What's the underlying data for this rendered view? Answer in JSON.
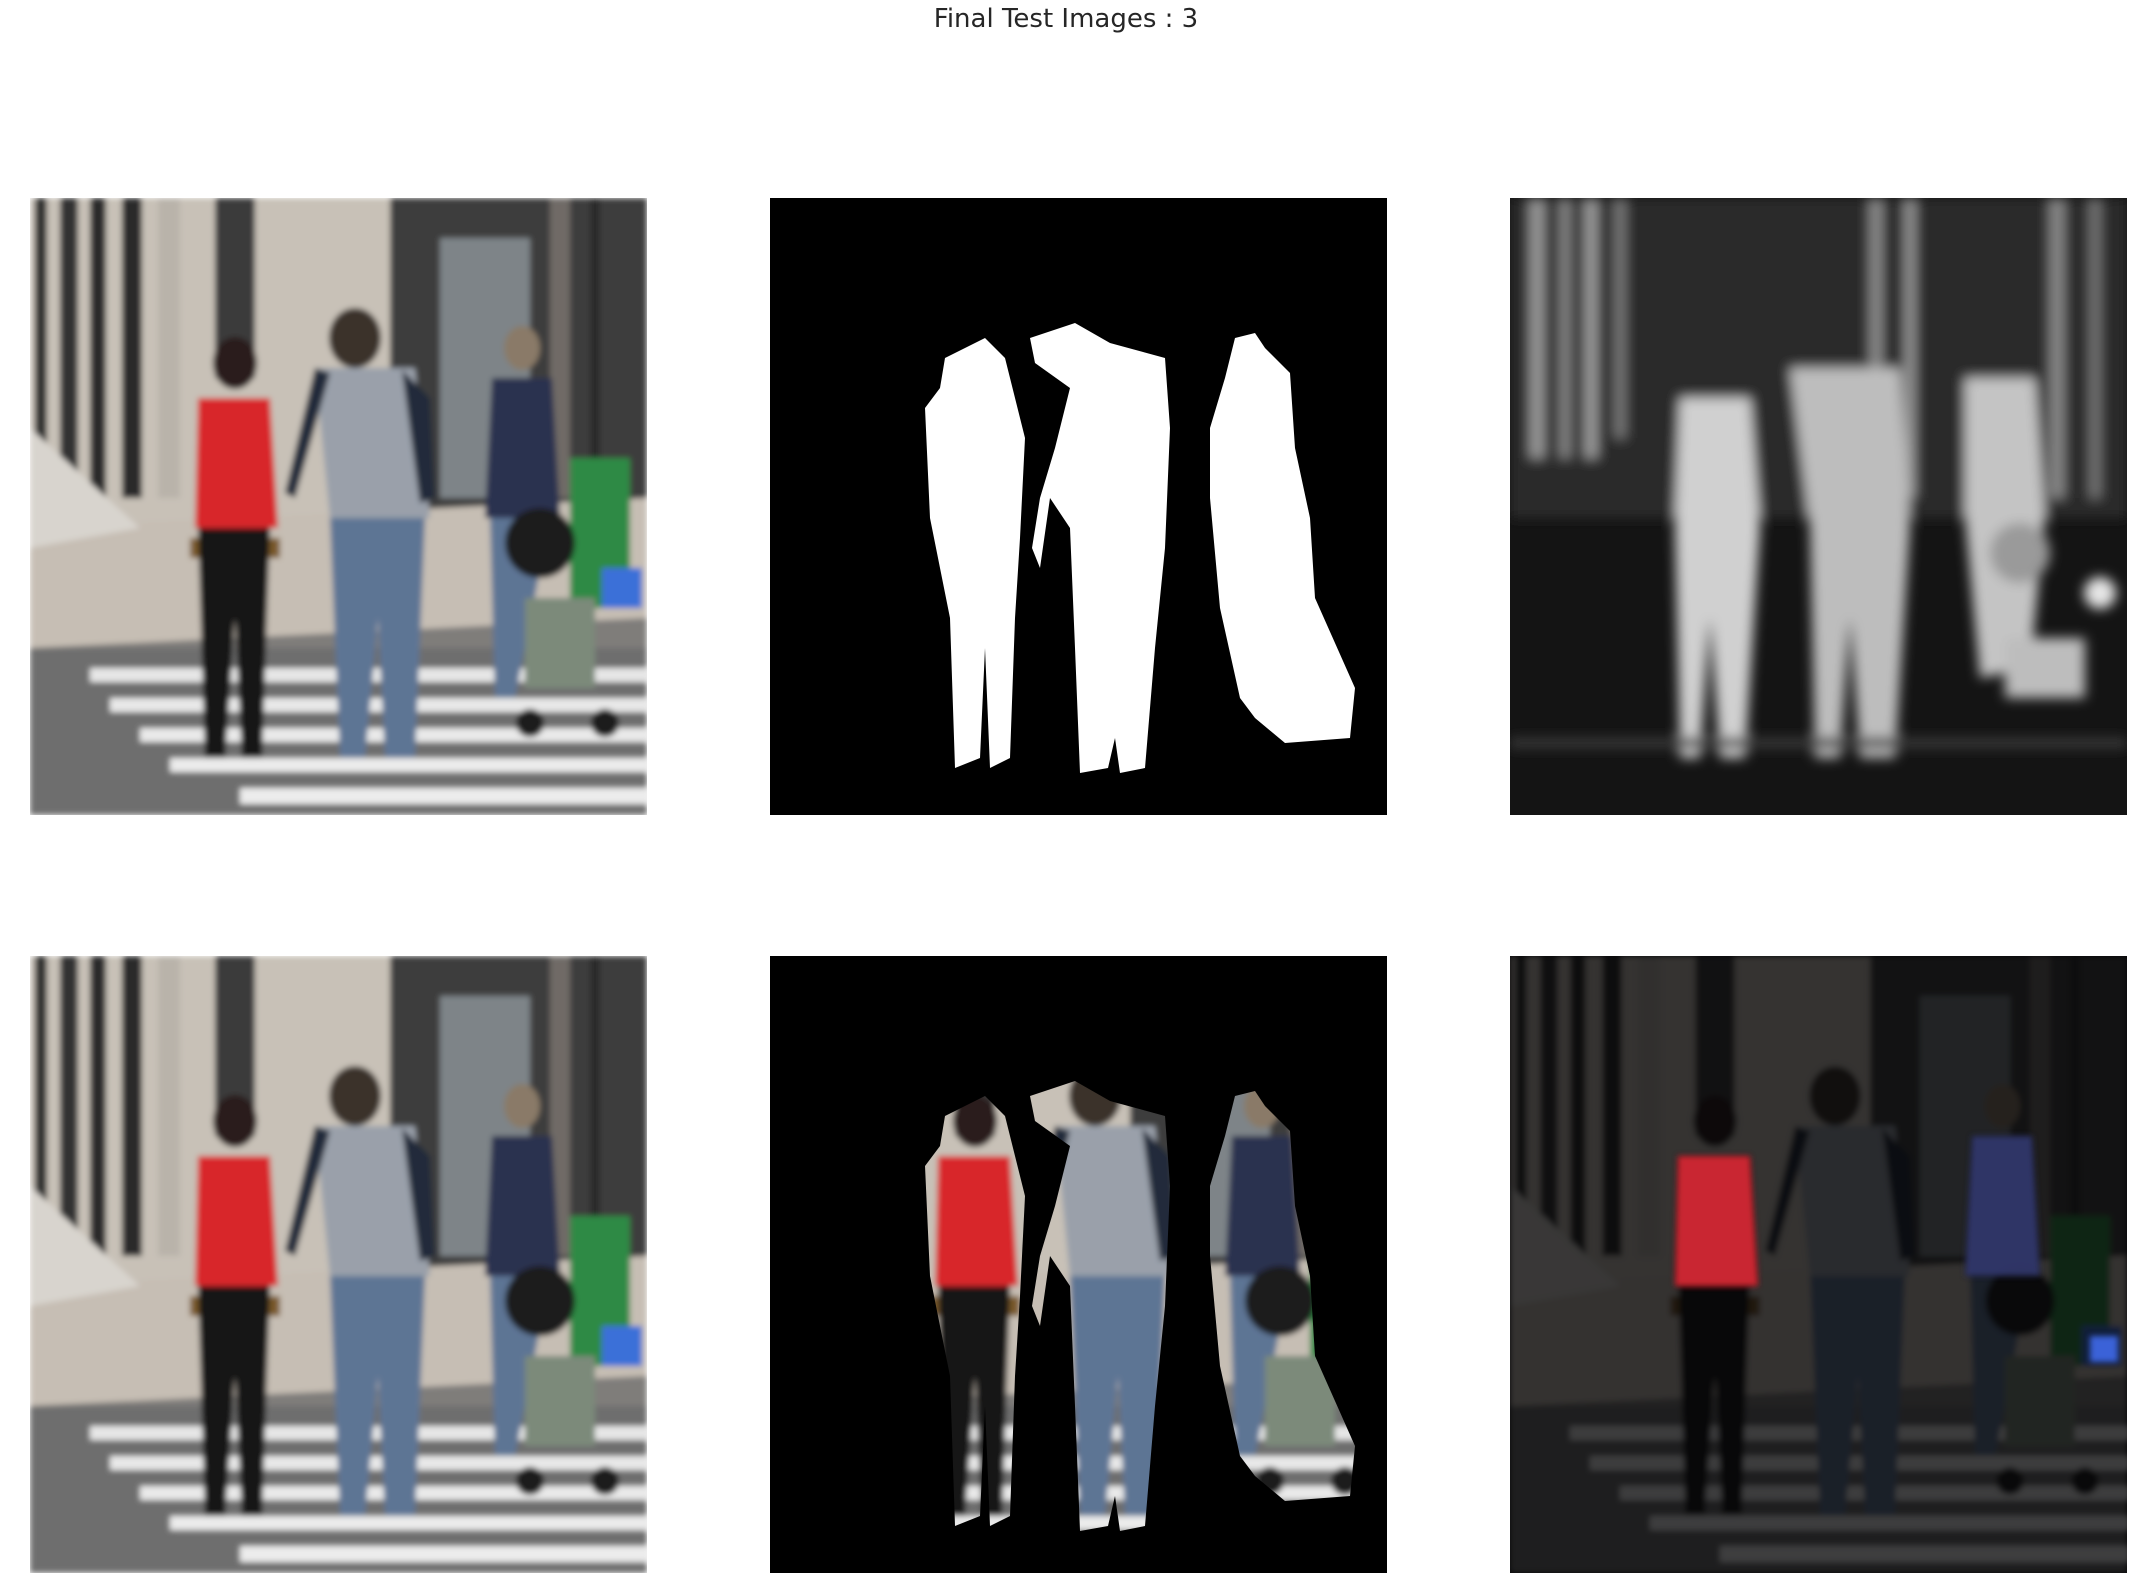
{
  "figure": {
    "title": "Final Test Images : 3"
  },
  "panels": [
    {
      "id": "input-image",
      "row": 1,
      "col": 1,
      "kind": "rgb-photo"
    },
    {
      "id": "ground-truth-mask",
      "row": 1,
      "col": 2,
      "kind": "binary-mask"
    },
    {
      "id": "predicted-map",
      "row": 1,
      "col": 3,
      "kind": "grayscale-map"
    },
    {
      "id": "input-image-copy",
      "row": 2,
      "col": 1,
      "kind": "rgb-photo"
    },
    {
      "id": "masked-image",
      "row": 2,
      "col": 2,
      "kind": "masked-photo"
    },
    {
      "id": "predicted-overlay",
      "row": 2,
      "col": 3,
      "kind": "dark-overlay"
    }
  ],
  "colors": {
    "background": "#ffffff",
    "shirt_red": "#d8262c",
    "jacket_navy": "#2a3350",
    "jeans_blue": "#5d7494",
    "mask_white": "#ffffff",
    "mask_black": "#000000"
  }
}
